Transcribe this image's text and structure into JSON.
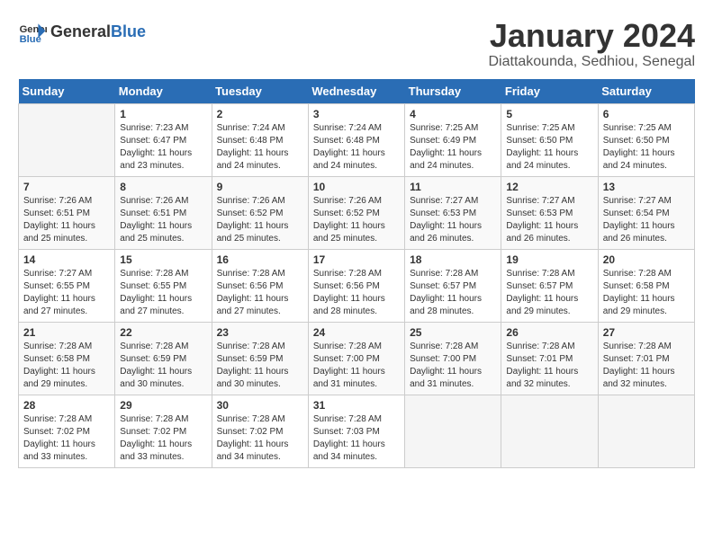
{
  "header": {
    "logo_general": "General",
    "logo_blue": "Blue",
    "month_title": "January 2024",
    "location": "Diattakounda, Sedhiou, Senegal"
  },
  "days_of_week": [
    "Sunday",
    "Monday",
    "Tuesday",
    "Wednesday",
    "Thursday",
    "Friday",
    "Saturday"
  ],
  "weeks": [
    [
      {
        "day": "",
        "sunrise": "",
        "sunset": "",
        "daylight": ""
      },
      {
        "day": "1",
        "sunrise": "Sunrise: 7:23 AM",
        "sunset": "Sunset: 6:47 PM",
        "daylight": "Daylight: 11 hours and 23 minutes."
      },
      {
        "day": "2",
        "sunrise": "Sunrise: 7:24 AM",
        "sunset": "Sunset: 6:48 PM",
        "daylight": "Daylight: 11 hours and 24 minutes."
      },
      {
        "day": "3",
        "sunrise": "Sunrise: 7:24 AM",
        "sunset": "Sunset: 6:48 PM",
        "daylight": "Daylight: 11 hours and 24 minutes."
      },
      {
        "day": "4",
        "sunrise": "Sunrise: 7:25 AM",
        "sunset": "Sunset: 6:49 PM",
        "daylight": "Daylight: 11 hours and 24 minutes."
      },
      {
        "day": "5",
        "sunrise": "Sunrise: 7:25 AM",
        "sunset": "Sunset: 6:50 PM",
        "daylight": "Daylight: 11 hours and 24 minutes."
      },
      {
        "day": "6",
        "sunrise": "Sunrise: 7:25 AM",
        "sunset": "Sunset: 6:50 PM",
        "daylight": "Daylight: 11 hours and 24 minutes."
      }
    ],
    [
      {
        "day": "7",
        "sunrise": "Sunrise: 7:26 AM",
        "sunset": "Sunset: 6:51 PM",
        "daylight": "Daylight: 11 hours and 25 minutes."
      },
      {
        "day": "8",
        "sunrise": "Sunrise: 7:26 AM",
        "sunset": "Sunset: 6:51 PM",
        "daylight": "Daylight: 11 hours and 25 minutes."
      },
      {
        "day": "9",
        "sunrise": "Sunrise: 7:26 AM",
        "sunset": "Sunset: 6:52 PM",
        "daylight": "Daylight: 11 hours and 25 minutes."
      },
      {
        "day": "10",
        "sunrise": "Sunrise: 7:26 AM",
        "sunset": "Sunset: 6:52 PM",
        "daylight": "Daylight: 11 hours and 25 minutes."
      },
      {
        "day": "11",
        "sunrise": "Sunrise: 7:27 AM",
        "sunset": "Sunset: 6:53 PM",
        "daylight": "Daylight: 11 hours and 26 minutes."
      },
      {
        "day": "12",
        "sunrise": "Sunrise: 7:27 AM",
        "sunset": "Sunset: 6:53 PM",
        "daylight": "Daylight: 11 hours and 26 minutes."
      },
      {
        "day": "13",
        "sunrise": "Sunrise: 7:27 AM",
        "sunset": "Sunset: 6:54 PM",
        "daylight": "Daylight: 11 hours and 26 minutes."
      }
    ],
    [
      {
        "day": "14",
        "sunrise": "Sunrise: 7:27 AM",
        "sunset": "Sunset: 6:55 PM",
        "daylight": "Daylight: 11 hours and 27 minutes."
      },
      {
        "day": "15",
        "sunrise": "Sunrise: 7:28 AM",
        "sunset": "Sunset: 6:55 PM",
        "daylight": "Daylight: 11 hours and 27 minutes."
      },
      {
        "day": "16",
        "sunrise": "Sunrise: 7:28 AM",
        "sunset": "Sunset: 6:56 PM",
        "daylight": "Daylight: 11 hours and 27 minutes."
      },
      {
        "day": "17",
        "sunrise": "Sunrise: 7:28 AM",
        "sunset": "Sunset: 6:56 PM",
        "daylight": "Daylight: 11 hours and 28 minutes."
      },
      {
        "day": "18",
        "sunrise": "Sunrise: 7:28 AM",
        "sunset": "Sunset: 6:57 PM",
        "daylight": "Daylight: 11 hours and 28 minutes."
      },
      {
        "day": "19",
        "sunrise": "Sunrise: 7:28 AM",
        "sunset": "Sunset: 6:57 PM",
        "daylight": "Daylight: 11 hours and 29 minutes."
      },
      {
        "day": "20",
        "sunrise": "Sunrise: 7:28 AM",
        "sunset": "Sunset: 6:58 PM",
        "daylight": "Daylight: 11 hours and 29 minutes."
      }
    ],
    [
      {
        "day": "21",
        "sunrise": "Sunrise: 7:28 AM",
        "sunset": "Sunset: 6:58 PM",
        "daylight": "Daylight: 11 hours and 29 minutes."
      },
      {
        "day": "22",
        "sunrise": "Sunrise: 7:28 AM",
        "sunset": "Sunset: 6:59 PM",
        "daylight": "Daylight: 11 hours and 30 minutes."
      },
      {
        "day": "23",
        "sunrise": "Sunrise: 7:28 AM",
        "sunset": "Sunset: 6:59 PM",
        "daylight": "Daylight: 11 hours and 30 minutes."
      },
      {
        "day": "24",
        "sunrise": "Sunrise: 7:28 AM",
        "sunset": "Sunset: 7:00 PM",
        "daylight": "Daylight: 11 hours and 31 minutes."
      },
      {
        "day": "25",
        "sunrise": "Sunrise: 7:28 AM",
        "sunset": "Sunset: 7:00 PM",
        "daylight": "Daylight: 11 hours and 31 minutes."
      },
      {
        "day": "26",
        "sunrise": "Sunrise: 7:28 AM",
        "sunset": "Sunset: 7:01 PM",
        "daylight": "Daylight: 11 hours and 32 minutes."
      },
      {
        "day": "27",
        "sunrise": "Sunrise: 7:28 AM",
        "sunset": "Sunset: 7:01 PM",
        "daylight": "Daylight: 11 hours and 32 minutes."
      }
    ],
    [
      {
        "day": "28",
        "sunrise": "Sunrise: 7:28 AM",
        "sunset": "Sunset: 7:02 PM",
        "daylight": "Daylight: 11 hours and 33 minutes."
      },
      {
        "day": "29",
        "sunrise": "Sunrise: 7:28 AM",
        "sunset": "Sunset: 7:02 PM",
        "daylight": "Daylight: 11 hours and 33 minutes."
      },
      {
        "day": "30",
        "sunrise": "Sunrise: 7:28 AM",
        "sunset": "Sunset: 7:02 PM",
        "daylight": "Daylight: 11 hours and 34 minutes."
      },
      {
        "day": "31",
        "sunrise": "Sunrise: 7:28 AM",
        "sunset": "Sunset: 7:03 PM",
        "daylight": "Daylight: 11 hours and 34 minutes."
      },
      {
        "day": "",
        "sunrise": "",
        "sunset": "",
        "daylight": ""
      },
      {
        "day": "",
        "sunrise": "",
        "sunset": "",
        "daylight": ""
      },
      {
        "day": "",
        "sunrise": "",
        "sunset": "",
        "daylight": ""
      }
    ]
  ]
}
